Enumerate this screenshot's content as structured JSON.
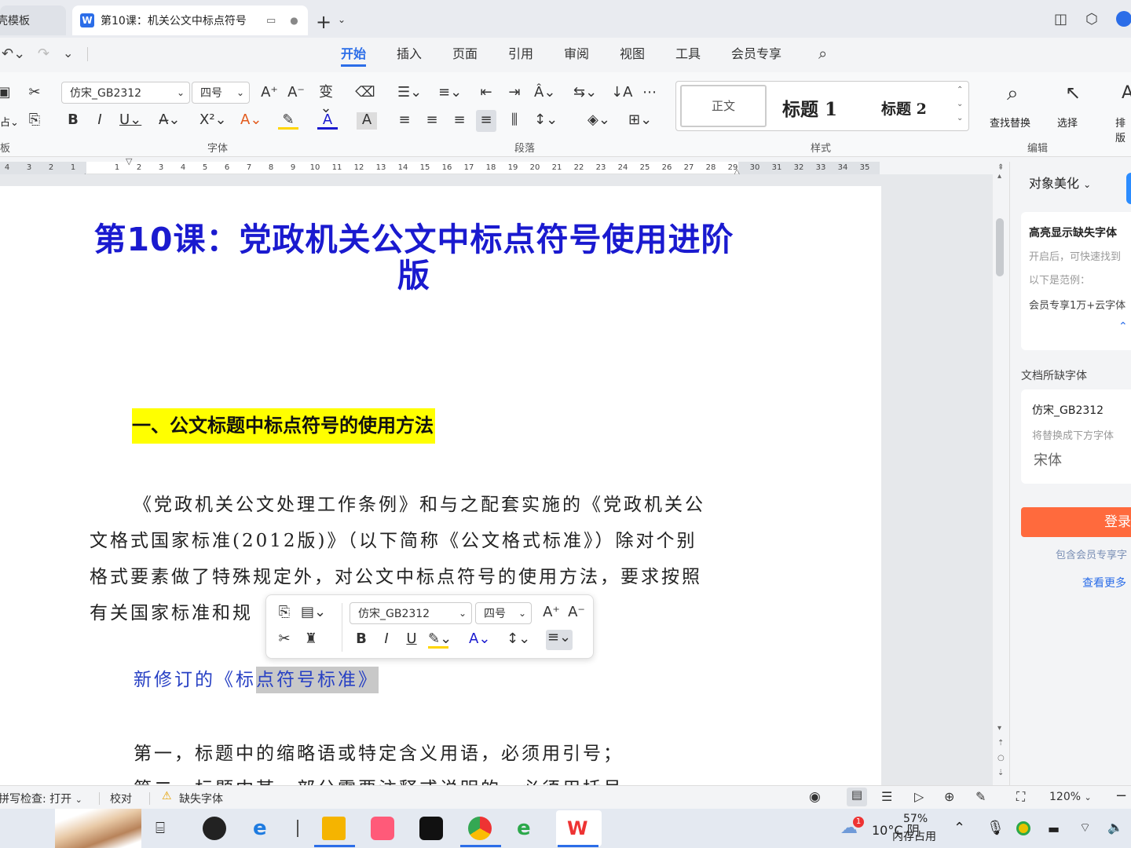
{
  "tabs": {
    "tab1": "壳模板",
    "tab2": "第10课：机关公文中标点符号"
  },
  "menu": [
    "开始",
    "插入",
    "页面",
    "引用",
    "审阅",
    "视图",
    "工具",
    "会员专享"
  ],
  "ribbon": {
    "font_name": "仿宋_GB2312",
    "font_size": "四号",
    "groups": {
      "clipboard": "板",
      "font": "字体",
      "paragraph": "段落",
      "styles": "样式",
      "edit": "编辑"
    },
    "styles": {
      "normal": "正文",
      "h1": "标题 1",
      "h2": "标题 2"
    },
    "find": "查找替换",
    "select": "选择",
    "arrange": "排版"
  },
  "ruler": [
    "4",
    "3",
    "2",
    "1",
    "",
    "1",
    "2",
    "3",
    "4",
    "5",
    "6",
    "7",
    "8",
    "9",
    "10",
    "11",
    "12",
    "13",
    "14",
    "15",
    "16",
    "17",
    "18",
    "19",
    "20",
    "21",
    "22",
    "23",
    "24",
    "25",
    "26",
    "27",
    "28",
    "29",
    "30",
    "31",
    "32",
    "33",
    "34",
    "35"
  ],
  "doc": {
    "title_l1": "第10课：党政机关公文中标点符号使用进阶",
    "title_l2": "版",
    "heading1": "一、公文标题中标点符号的使用方法",
    "p1_l1": "《党政机关公文处理工作条例》和与之配套实施的《党政机关公",
    "p1_l2": "文格式国家标准(2012版)》（以下简称《公文格式标准》）除对个别",
    "p1_l3": "格式要素做了特殊规定外，对公文中标点符号的使用方法，要求按照",
    "p1_l4": "有关国家标准和规",
    "p2_pre": "新修订的《标",
    "p2_sel": "点符号标准》",
    "p3": "第一，标题中的缩略语或特定含义用语，必须用引号；",
    "p4": "第二，标题中某一部分需要注释或说明的，必须用括号"
  },
  "mini": {
    "font": "仿宋_GB2312",
    "size": "四号"
  },
  "panel": {
    "title": "对象美化",
    "card1_title": "高亮显示缺失字体",
    "card1_l1": "开启后，可快速找到",
    "card1_l2": "以下是范例：",
    "card1_l3": "会员专享1万+云字体",
    "missing_label": "文档所缺字体",
    "missing_font": "仿宋_GB2312",
    "replace_hint": "将替换成下方字体",
    "replace_font": "宋体",
    "login": "登录",
    "member_note": "包含会员专享字",
    "more": "查看更多"
  },
  "status": {
    "spell": "拼写检查: 打开",
    "proof": "校对",
    "missing": "缺失字体",
    "zoom": "120%"
  },
  "taskbar": {
    "weather": "10°C 阴",
    "mem_pct": "57%",
    "mem_label": "内存占用",
    "badge": "1"
  },
  "colors": {
    "accent": "#2b6de8",
    "title": "#1a1acf",
    "highlight": "#ffff00",
    "login": "#ff6a3d"
  }
}
